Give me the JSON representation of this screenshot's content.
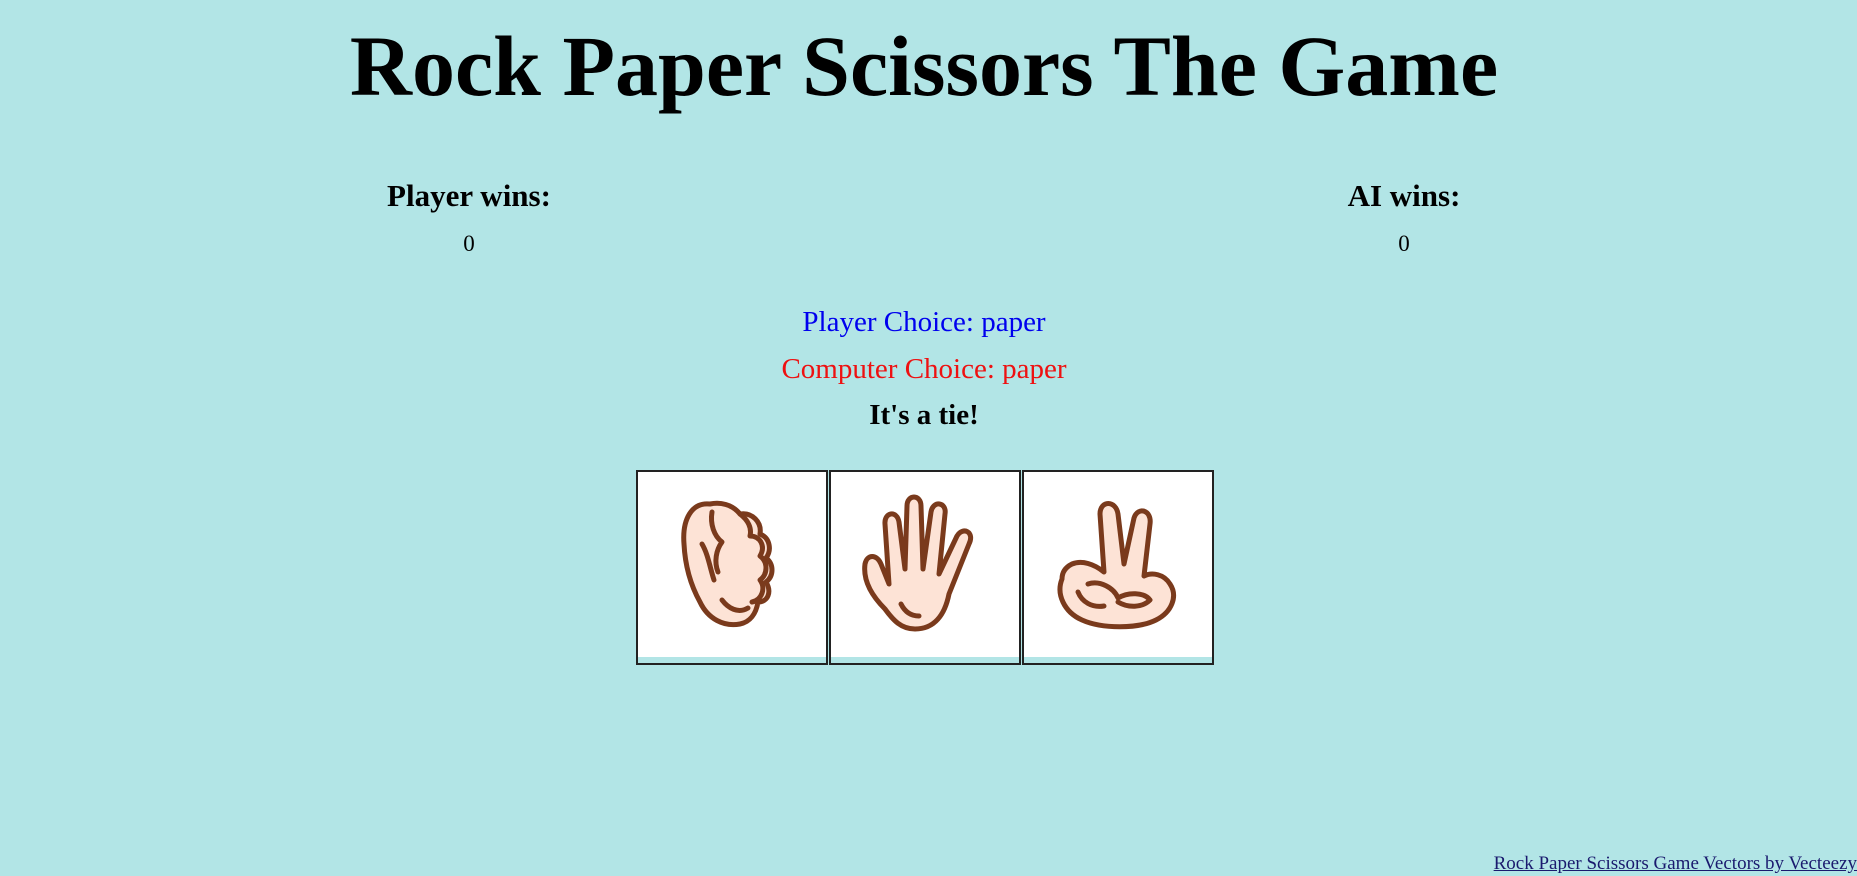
{
  "title": "Rock Paper Scissors The Game",
  "scores": {
    "player_label": "Player wins:",
    "player_value": "0",
    "ai_label": "AI wins:",
    "ai_value": "0"
  },
  "choices": {
    "player": "Player Choice: paper",
    "computer": "Computer Choice: paper"
  },
  "result": "It's a tie!",
  "buttons": [
    {
      "name": "rock",
      "icon": "rock-hand-icon"
    },
    {
      "name": "paper",
      "icon": "paper-hand-icon"
    },
    {
      "name": "scissors",
      "icon": "scissors-hand-icon"
    }
  ],
  "colors": {
    "background": "#b2e5e6",
    "player_choice": "#0000ee",
    "computer_choice": "#ee1111",
    "hand_fill": "#fde3d6",
    "hand_outline": "#7a3a1c"
  },
  "credit": {
    "text": "Rock Paper Scissors Game Vectors by Vecteezy"
  }
}
